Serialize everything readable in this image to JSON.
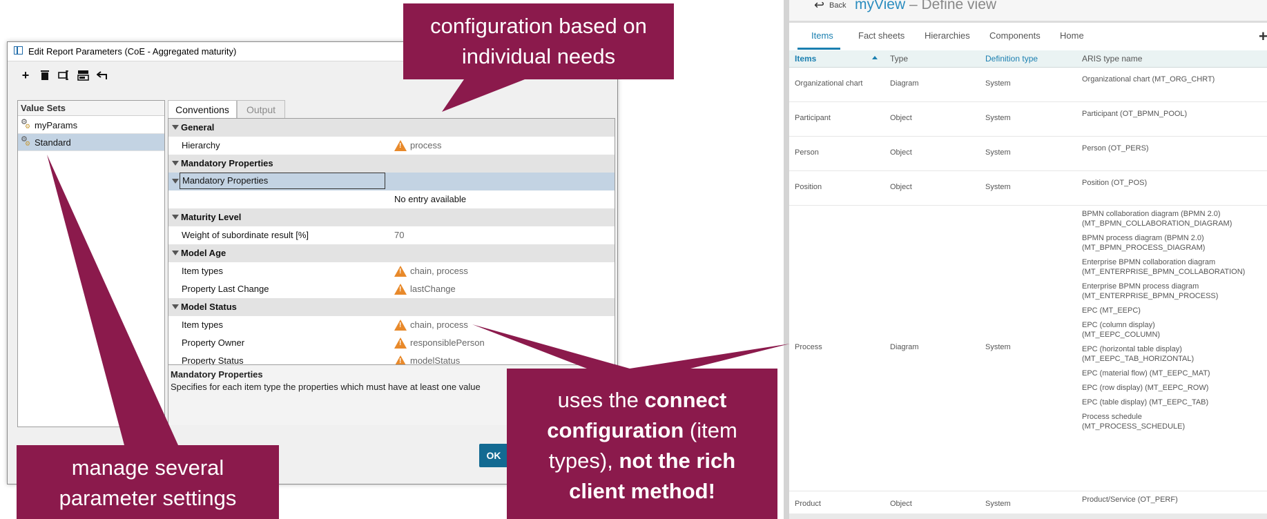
{
  "dialog": {
    "title": "Edit Report Parameters (CoE - Aggregated maturity)",
    "toolbar": [
      "add",
      "delete",
      "rename",
      "copy",
      "undo"
    ],
    "value_sets": {
      "header": "Value Sets",
      "items": [
        {
          "label": "myParams",
          "selected": false
        },
        {
          "label": "Standard",
          "selected": true
        }
      ]
    },
    "tabs": [
      {
        "label": "Conventions",
        "active": true
      },
      {
        "label": "Output",
        "active": false
      }
    ],
    "properties": [
      {
        "kind": "group",
        "label": "General"
      },
      {
        "kind": "row",
        "label": "Hierarchy",
        "value": "process",
        "warning": true
      },
      {
        "kind": "group",
        "label": "Mandatory Properties"
      },
      {
        "kind": "subgroup",
        "label": "Mandatory Properties",
        "selected": true
      },
      {
        "kind": "row",
        "label": "",
        "value": "No entry available",
        "warning": false,
        "dark": true
      },
      {
        "kind": "group",
        "label": "Maturity Level"
      },
      {
        "kind": "row",
        "label": "Weight of subordinate result [%]",
        "value": "70",
        "warning": false
      },
      {
        "kind": "group",
        "label": "Model Age"
      },
      {
        "kind": "row",
        "label": "Item types",
        "value": "chain, process",
        "warning": true
      },
      {
        "kind": "row",
        "label": "Property Last Change",
        "value": "lastChange",
        "warning": true
      },
      {
        "kind": "group",
        "label": "Model Status"
      },
      {
        "kind": "row",
        "label": "Item types",
        "value": "chain, process",
        "warning": true
      },
      {
        "kind": "row",
        "label": "Property Owner",
        "value": "responsiblePerson",
        "warning": true
      },
      {
        "kind": "row",
        "label": "Property Status",
        "value": "modelStatus",
        "warning": true
      }
    ],
    "description": {
      "title": "Mandatory Properties",
      "text": "Specifies for each item type the properties which must have at least one value"
    },
    "ok_label": "OK"
  },
  "right_panel": {
    "back_label": "Back",
    "title_highlight": "myView",
    "title_rest": " – Define view",
    "tabs": [
      {
        "label": "Items",
        "active": true
      },
      {
        "label": "Fact sheets",
        "active": false
      },
      {
        "label": "Hierarchies",
        "active": false
      },
      {
        "label": "Components",
        "active": false
      },
      {
        "label": "Home",
        "active": false
      }
    ],
    "columns": [
      "Items",
      "Type",
      "Definition type",
      "ARIS type name"
    ],
    "rows": [
      {
        "item": "Organizational chart",
        "type": "Diagram",
        "def": "System",
        "names": [
          "Organizational chart (MT_ORG_CHRT)"
        ]
      },
      {
        "item": "Participant",
        "type": "Object",
        "def": "System",
        "names": [
          "Participant (OT_BPMN_POOL)"
        ]
      },
      {
        "item": "Person",
        "type": "Object",
        "def": "System",
        "names": [
          "Person (OT_PERS)"
        ]
      },
      {
        "item": "Position",
        "type": "Object",
        "def": "System",
        "names": [
          "Position (OT_POS)"
        ]
      },
      {
        "item": "Process",
        "type": "Diagram",
        "def": "System",
        "names": [
          "BPMN collaboration diagram (BPMN 2.0) (MT_BPMN_COLLABORATION_DIAGRAM)",
          "BPMN process diagram (BPMN 2.0) (MT_BPMN_PROCESS_DIAGRAM)",
          "Enterprise BPMN collaboration diagram (MT_ENTERPRISE_BPMN_COLLABORATION)",
          "Enterprise BPMN process diagram (MT_ENTERPRISE_BPMN_PROCESS)",
          "EPC (MT_EEPC)",
          "EPC (column display) (MT_EEPC_COLUMN)",
          "EPC (horizontal table display) (MT_EEPC_TAB_HORIZONTAL)",
          "EPC (material flow) (MT_EEPC_MAT)",
          "EPC (row display) (MT_EEPC_ROW)",
          "EPC (table display) (MT_EEPC_TAB)",
          "Process schedule (MT_PROCESS_SCHEDULE)"
        ]
      },
      {
        "item": "Product",
        "type": "Object",
        "def": "System",
        "names": [
          "Product/Service (OT_PERF)"
        ]
      }
    ]
  },
  "callouts": {
    "top": [
      "configuration based on",
      "individual needs"
    ],
    "bottom_left": [
      "manage several",
      "parameter settings"
    ],
    "bottom_right": {
      "l1_a": "uses the ",
      "l1_b": "connect",
      "l2_a": "configuration",
      "l2_b": " (item",
      "l3_a": "types), ",
      "l3_b": "not the rich",
      "l4": "client method!"
    },
    "color": "#8b1a4c"
  }
}
